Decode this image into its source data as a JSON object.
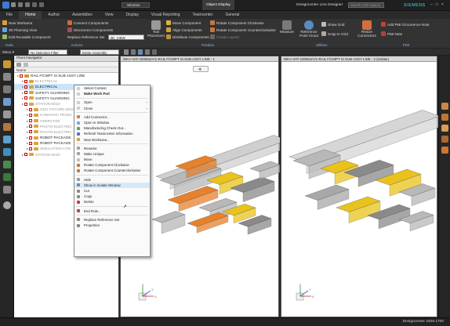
{
  "titlebar": {
    "object_label": "Object Display",
    "window_menu": "Window",
    "app_title": "Designcenter  Line Designer",
    "search_placeholder": "Search (Ctrl+Space)",
    "brand": "SIEMENS"
  },
  "menu_tabs": [
    "File",
    "Home",
    "Author",
    "Assemblies",
    "View",
    "Display",
    "Visual Reporting",
    "Teamcenter",
    "General"
  ],
  "ribbon": {
    "col1": [
      "New Workarea",
      "3D Planning View",
      "Edit Reusable Component"
    ],
    "col2": [
      "Connect Components",
      "Disconnect Components"
    ],
    "replace_label": "Replace Reference Set",
    "replace_value": "3D_VIEW",
    "big_buttons": [
      "Tool Placement"
    ],
    "col3": [
      "Move Component",
      "Align Components",
      "Distribute Components"
    ],
    "col4": [
      "Rotate Component Clockwise",
      "Rotate Component Counterclockwise",
      "Create Layout"
    ],
    "big2": [
      "Measure",
      "Reference Point Cloud"
    ],
    "col5": [
      "Show Grid",
      "Snap to Grid"
    ],
    "big3": [
      "Resize Connectors"
    ],
    "col6": [
      "Add PMI Occurrence Note",
      "PMI Note"
    ],
    "groups": [
      "Data",
      "Actions",
      "Position",
      "Utilities",
      "PMI"
    ]
  },
  "filterbar": {
    "menu_label": "Menu",
    "filter_value": "No Selection Filter",
    "assembly_value": "Entire Assembly"
  },
  "navigator": {
    "title": "Plant Navigator",
    "column": "Name",
    "rows": [
      {
        "label": "RAIL F/CMPT SI SUB ASSY LINE",
        "indent": 0,
        "sel": false,
        "dim": false
      },
      {
        "label": "ELECTRICAL",
        "indent": 1,
        "sel": false,
        "dim": true
      },
      {
        "label": "ELECTRICAL",
        "indent": 1,
        "sel": true,
        "dim": false
      },
      {
        "label": "SAFETY GUARDING",
        "indent": 1,
        "sel": false,
        "dim": false
      },
      {
        "label": "SAFETY GUARDING",
        "indent": 1,
        "sel": false,
        "dim": false
      },
      {
        "label": "STATION-D010",
        "indent": 1,
        "sel": false,
        "dim": true
      },
      {
        "label": "GEO FIXTURE-D010",
        "indent": 2,
        "sel": false,
        "dim": true
      },
      {
        "label": "KAWASAKI TRANS",
        "indent": 2,
        "sel": false,
        "dim": true
      },
      {
        "label": "OPERATOR",
        "indent": 2,
        "sel": false,
        "dim": true
      },
      {
        "label": "PHOTO-ELECTRIC",
        "indent": 2,
        "sel": false,
        "dim": true
      },
      {
        "label": "PHOTO-ELECTRIC T",
        "indent": 2,
        "sel": false,
        "dim": true
      },
      {
        "label": "ROBOT PACKAGE",
        "indent": 2,
        "sel": false,
        "dim": false
      },
      {
        "label": "ROBOT PACKAGE",
        "indent": 2,
        "sel": false,
        "dim": false
      },
      {
        "label": "SIMULATION CON",
        "indent": 2,
        "sel": false,
        "dim": true
      },
      {
        "label": "STATION-D020",
        "indent": 1,
        "sel": false,
        "dim": true
      }
    ]
  },
  "views": {
    "left_tab": "WKA-VAT-100064/A/1-RAIL F/CMPT SI SUB ASSY LINE : 1",
    "right_tab": "WKA-VAT-100064/A/1-RAIL F/CMPT SI SUB ASSY LINE : 2 (Isolate)",
    "axis_x": "X",
    "axis_y": "Y",
    "axis_z": "Z"
  },
  "context_menu": [
    {
      "label": "Select Context",
      "sep_after": false,
      "hl": false,
      "sub": false
    },
    {
      "label": "Make Work Part",
      "sep_after": true,
      "hl": false,
      "sub": false,
      "bold": true
    },
    {
      "label": "Open",
      "sep_after": false,
      "hl": false,
      "sub": true
    },
    {
      "label": "Close",
      "sep_after": true,
      "hl": false,
      "sub": true
    },
    {
      "label": "Add Connector...",
      "sep_after": false,
      "hl": false,
      "sub": false
    },
    {
      "label": "Open in Window",
      "sep_after": false,
      "hl": false,
      "sub": false
    },
    {
      "label": "Manufacturing Check-Out...",
      "sep_after": false,
      "hl": false,
      "sub": false
    },
    {
      "label": "Refresh Teamcenter Information",
      "sep_after": false,
      "hl": false,
      "sub": false
    },
    {
      "label": "New Workarea...",
      "sep_after": true,
      "hl": false,
      "sub": false
    },
    {
      "label": "Rename",
      "sep_after": false,
      "hl": false,
      "sub": false
    },
    {
      "label": "Make Unique",
      "sep_after": false,
      "hl": false,
      "sub": false
    },
    {
      "label": "Move",
      "sep_after": false,
      "hl": false,
      "sub": false
    },
    {
      "label": "Rotate Component Clockwise",
      "sep_after": false,
      "hl": false,
      "sub": false
    },
    {
      "label": "Rotate Component Counterclockwise",
      "sep_after": true,
      "hl": false,
      "sub": false
    },
    {
      "label": "Hide",
      "sep_after": false,
      "hl": false,
      "sub": false
    },
    {
      "label": "Show in Isolate Window",
      "sep_after": false,
      "hl": true,
      "sub": false
    },
    {
      "label": "Cut",
      "sep_after": false,
      "hl": false,
      "sub": false
    },
    {
      "label": "Copy",
      "sep_after": false,
      "hl": false,
      "sub": false
    },
    {
      "label": "Delete",
      "sep_after": true,
      "hl": false,
      "sub": false
    },
    {
      "label": "End Role...",
      "sep_after": true,
      "hl": false,
      "sub": false
    },
    {
      "label": "Replace Reference Set",
      "sep_after": false,
      "hl": false,
      "sub": false
    },
    {
      "label": "Properties",
      "sep_after": false,
      "hl": false,
      "sub": false
    }
  ],
  "status": {
    "version": "Designcenter 2406.1700"
  },
  "colors": {
    "accent": "#3a7bd5",
    "selection": "#cce4f7",
    "orange_part": "#e8812b",
    "yellow_robot": "#e9c31c",
    "check_red": "#cc0000"
  }
}
